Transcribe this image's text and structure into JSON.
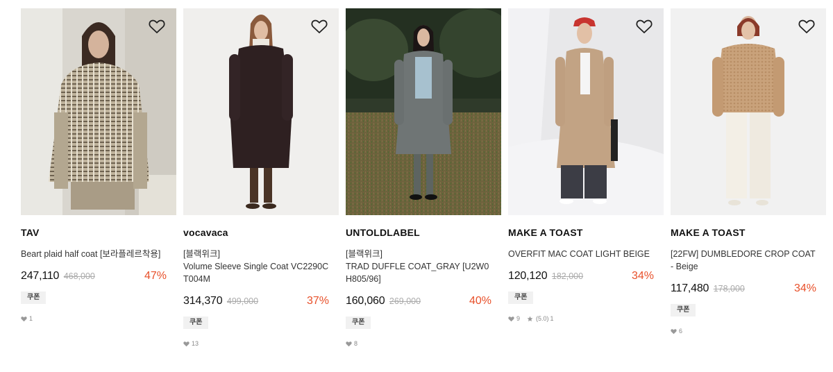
{
  "products": [
    {
      "brand": "TAV",
      "tag": "",
      "title": "Beart plaid half coat [보라플레르착용]",
      "price": "247,110",
      "original_price": "468,000",
      "discount": "47%",
      "badge": "쿠폰",
      "likes": "1",
      "rating": "",
      "reviews": ""
    },
    {
      "brand": "vocavaca",
      "tag": "[블랙위크]",
      "title": "Volume Sleeve Single Coat VC2290CT004M",
      "price": "314,370",
      "original_price": "499,000",
      "discount": "37%",
      "badge": "쿠폰",
      "likes": "13",
      "rating": "",
      "reviews": ""
    },
    {
      "brand": "UNTOLDLABEL",
      "tag": "[블랙위크]",
      "title": "TRAD DUFFLE COAT_GRAY [U2W0H805/96]",
      "price": "160,060",
      "original_price": "269,000",
      "discount": "40%",
      "badge": "쿠폰",
      "likes": "8",
      "rating": "",
      "reviews": ""
    },
    {
      "brand": "MAKE A TOAST",
      "tag": "",
      "title": "OVERFIT MAC COAT LIGHT BEIGE",
      "price": "120,120",
      "original_price": "182,000",
      "discount": "34%",
      "badge": "쿠폰",
      "likes": "9",
      "rating": "(5.0)",
      "reviews": "1"
    },
    {
      "brand": "MAKE A TOAST",
      "tag": "",
      "title": "[22FW] DUMBLEDORE CROP COAT - Beige",
      "price": "117,480",
      "original_price": "178,000",
      "discount": "34%",
      "badge": "쿠폰",
      "likes": "6",
      "rating": "",
      "reviews": ""
    }
  ],
  "icons": {
    "wishlist": "heart-outline-icon",
    "likes": "heart-filled-icon",
    "rating": "star-icon"
  },
  "colors": {
    "discount": "#e8502a",
    "price": "#111111",
    "original_price": "#aaaaaa",
    "badge_bg": "#f1f1f1"
  }
}
